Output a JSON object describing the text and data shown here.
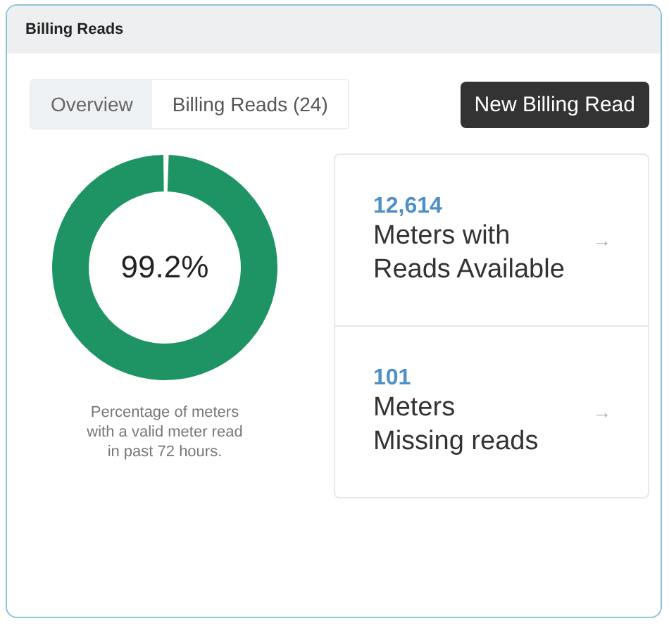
{
  "panel": {
    "title": "Billing Reads"
  },
  "tabs": [
    {
      "label": "Overview",
      "selected": true
    },
    {
      "label": "Billing Reads (24)",
      "selected": false
    }
  ],
  "action_button": "New Billing Read",
  "gauge": {
    "value": "99.2%",
    "level": 0.992,
    "caption": "Percentage of meters\nwith a valid meter read\nin past 72 hours."
  },
  "stats": [
    {
      "count": "12,614",
      "label": "Meters with\nReads Available",
      "arrow": "→"
    },
    {
      "count": "101",
      "label": "Meters\nMissing reads",
      "arrow": "→"
    }
  ]
}
